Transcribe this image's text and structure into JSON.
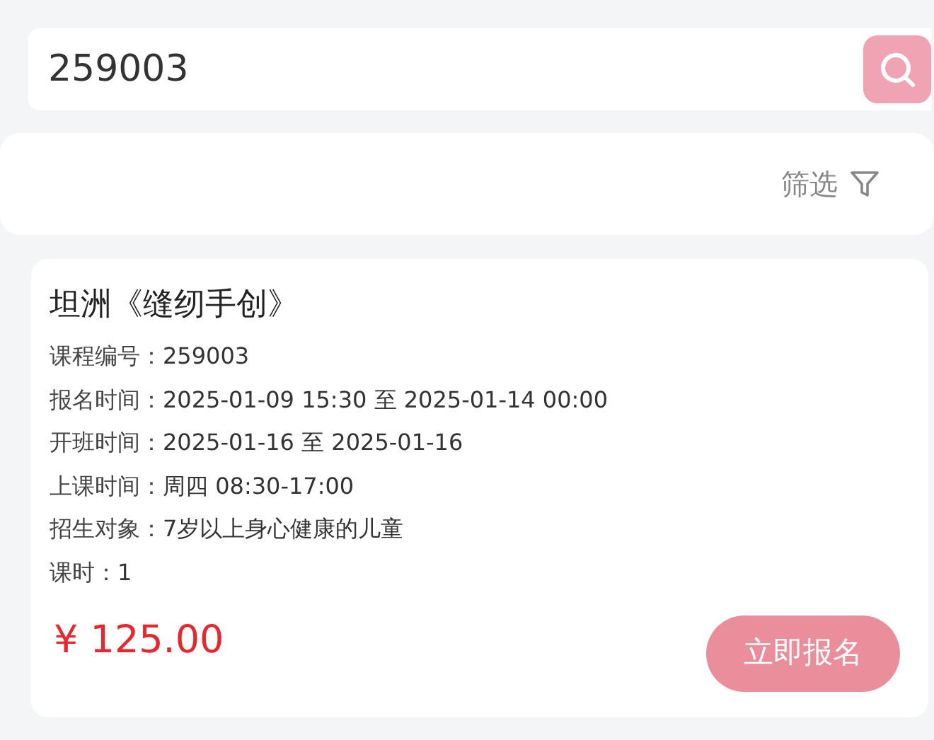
{
  "search": {
    "value": "259003"
  },
  "filter": {
    "label": "筛选"
  },
  "course": {
    "title": "坦洲《缝纫手创》",
    "fields": [
      {
        "label": "课程编号：",
        "value": "259003"
      },
      {
        "label": "报名时间：",
        "value": "2025-01-09 15:30 至 2025-01-14 00:00"
      },
      {
        "label": "开班时间：",
        "value": "2025-01-16 至 2025-01-16"
      },
      {
        "label": "上课时间：",
        "value": "周四 08:30-17:00"
      },
      {
        "label": "招生对象：",
        "value": "7岁以上身心健康的儿童"
      },
      {
        "label": "课时：",
        "value": "1"
      }
    ],
    "price": "¥ 125.00",
    "button": "立即报名"
  }
}
